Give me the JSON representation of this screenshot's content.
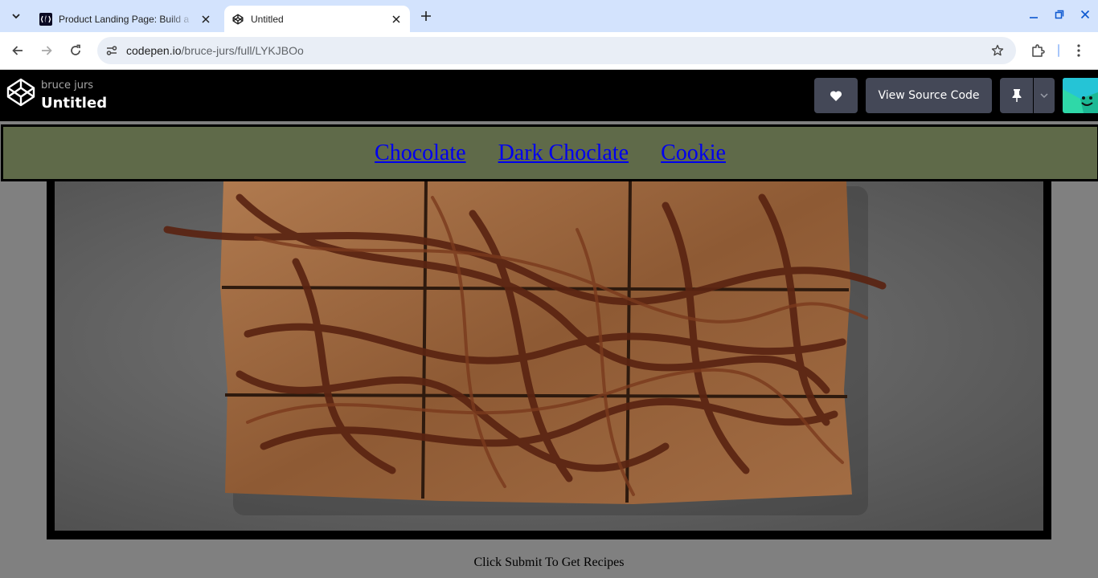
{
  "browser": {
    "tabs": [
      {
        "title": "Product Landing Page: Build a",
        "active": false
      },
      {
        "title": "Untitled",
        "active": true
      }
    ],
    "url_host": "codepen.io",
    "url_path": "/bruce-jurs/full/LYKJBOo"
  },
  "codepen": {
    "user": "bruce jurs",
    "pen_title": "Untitled",
    "view_source_label": "View Source Code"
  },
  "page": {
    "nav_links": [
      "Chocolate",
      "Dark Choclate",
      "Cookie"
    ],
    "cta_text": "Click Submit To Get Recipes"
  },
  "colors": {
    "tabstrip": "#d3e3fd",
    "codepen_header": "#000000",
    "button_bg": "#444857",
    "navbar_bg": "#5f6a49",
    "page_bg": "#808080",
    "link": "#0000ee"
  },
  "icons": {
    "tab_search": "chevron-down-icon",
    "codepen_favicon": "codepen-icon",
    "fcc_favicon": "freecodecamp-icon",
    "like": "heart-icon",
    "pin": "pin-icon"
  }
}
